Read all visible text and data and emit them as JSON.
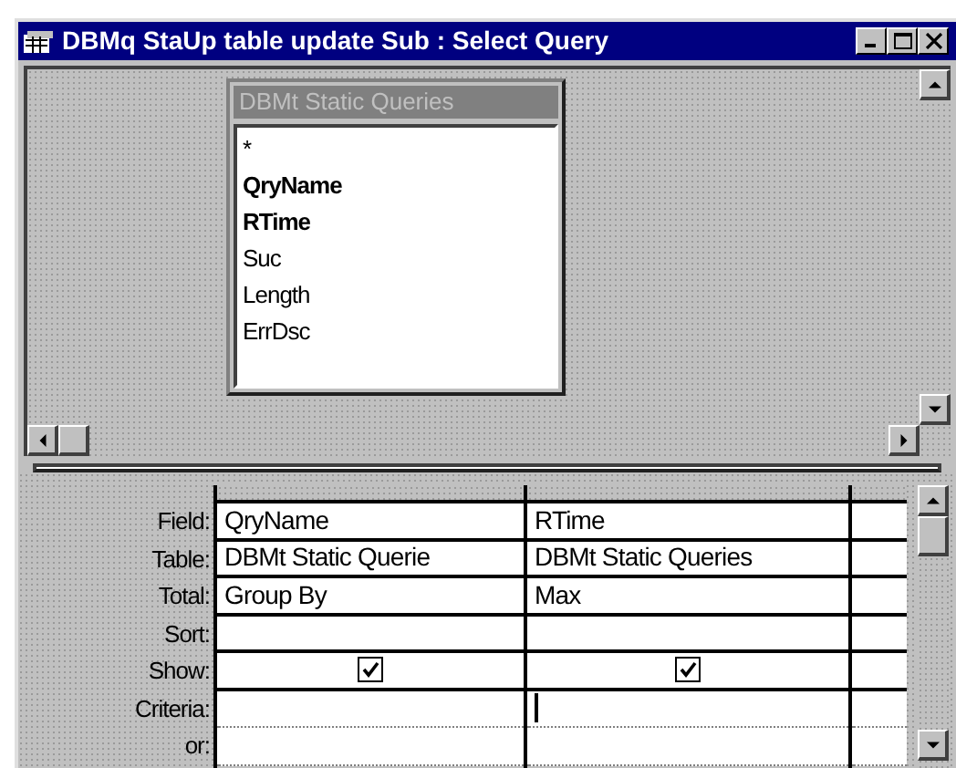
{
  "window": {
    "title": "DBMq StaUp table update Sub : Select Query"
  },
  "field_list": {
    "title": "DBMt Static Queries",
    "fields": [
      {
        "name": "*",
        "bold": false
      },
      {
        "name": "QryName",
        "bold": true
      },
      {
        "name": "RTime",
        "bold": true
      },
      {
        "name": "Suc",
        "bold": false
      },
      {
        "name": "Length",
        "bold": false
      },
      {
        "name": "ErrDsc",
        "bold": false
      }
    ]
  },
  "grid": {
    "row_labels": [
      "Field:",
      "Table:",
      "Total:",
      "Sort:",
      "Show:",
      "Criteria:",
      "or:"
    ],
    "columns": [
      {
        "field": "QryName",
        "table": "DBMt Static Querie",
        "total": "Group By",
        "show": true,
        "cursor": false
      },
      {
        "field": "RTime",
        "table": "DBMt Static Queries",
        "total": "Max",
        "show": true,
        "cursor": true
      }
    ]
  }
}
